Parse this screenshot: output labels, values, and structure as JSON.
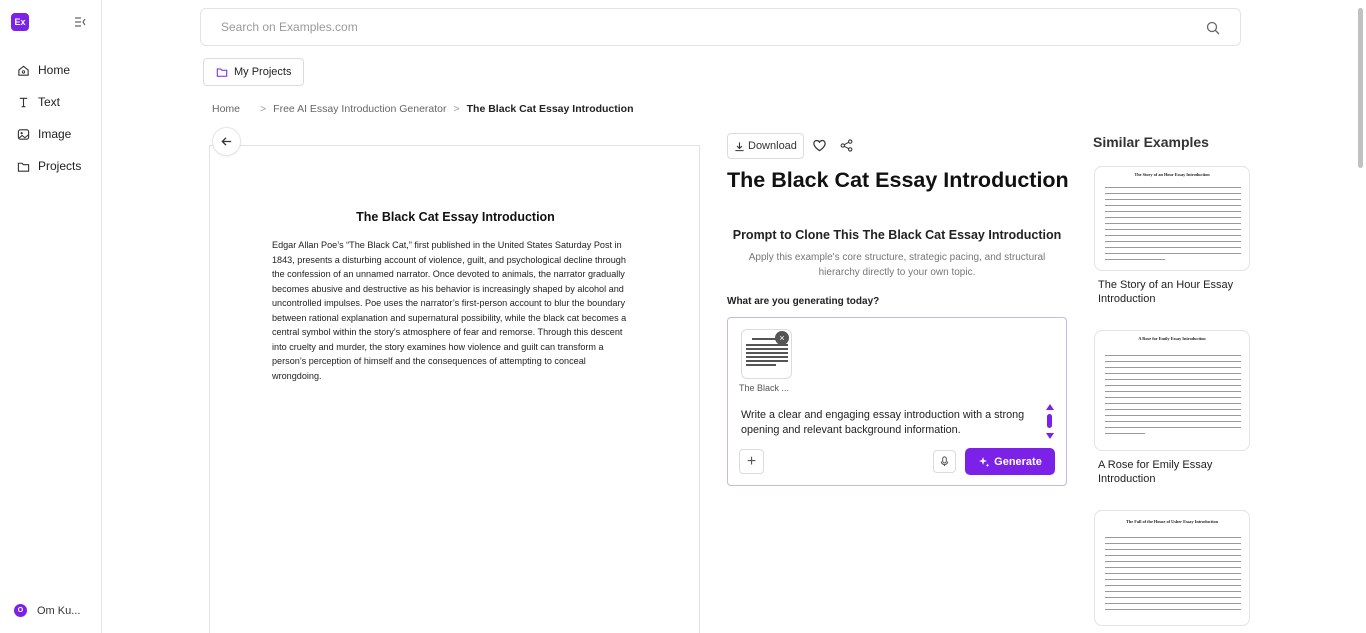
{
  "brand": {
    "logo_text": "Ex",
    "accent": "#7c22e8"
  },
  "sidebar": {
    "items": [
      {
        "label": "Home",
        "icon": "home-icon"
      },
      {
        "label": "Text",
        "icon": "text-icon"
      },
      {
        "label": "Image",
        "icon": "image-icon"
      },
      {
        "label": "Projects",
        "icon": "folder-icon"
      }
    ],
    "user": {
      "initial": "O",
      "name": "Om Ku..."
    }
  },
  "search": {
    "placeholder": "Search on Examples.com"
  },
  "my_projects": {
    "label": "My Projects"
  },
  "breadcrumb": [
    {
      "label": "Home"
    },
    {
      "label": "Free AI Essay Introduction Generator"
    },
    {
      "label": "The Black Cat Essay Introduction"
    }
  ],
  "document": {
    "title": "The Black Cat Essay Introduction",
    "body": "Edgar Allan Poe’s “The Black Cat,” first published in the United States Saturday Post in 1843, presents a disturbing account of violence, guilt, and psychological decline through the confession of an unnamed narrator. Once devoted to animals, the narrator gradually becomes abusive and destructive as his behavior is increasingly shaped by alcohol and uncontrolled impulses. Poe uses the narrator’s first-person account to blur the boundary between rational explanation and supernatural possibility, while the black cat becomes a central symbol within the story’s atmosphere of fear and remorse. Through this descent into cruelty and murder, the story examines how violence and guilt can transform a person’s perception of himself and the consequences of attempting to conceal wrongdoing."
  },
  "actions": {
    "download_label": "Download"
  },
  "main": {
    "title": "The Black Cat Essay Introduction",
    "prompt_heading": "Prompt to Clone This The Black Cat Essay Introduction",
    "prompt_sub": "Apply this example's core structure, strategic pacing, and structural hierarchy directly to your own topic.",
    "gen_question": "What are you generating today?",
    "attachment_label": "The Black ...",
    "prompt_text": "Write a clear and engaging essay introduction with a strong opening and relevant background information.",
    "generate_label": "Generate"
  },
  "similar": {
    "heading": "Similar Examples",
    "items": [
      {
        "label": "The Story of an Hour Essay Introduction",
        "thumb_title": "The Story of an Hour Essay Introduction"
      },
      {
        "label": "A Rose for Emily Essay Introduction",
        "thumb_title": "A Rose for Emily Essay Introduction"
      },
      {
        "label": "",
        "thumb_title": "The Fall of the House of Usher Essay Introduction"
      }
    ]
  }
}
